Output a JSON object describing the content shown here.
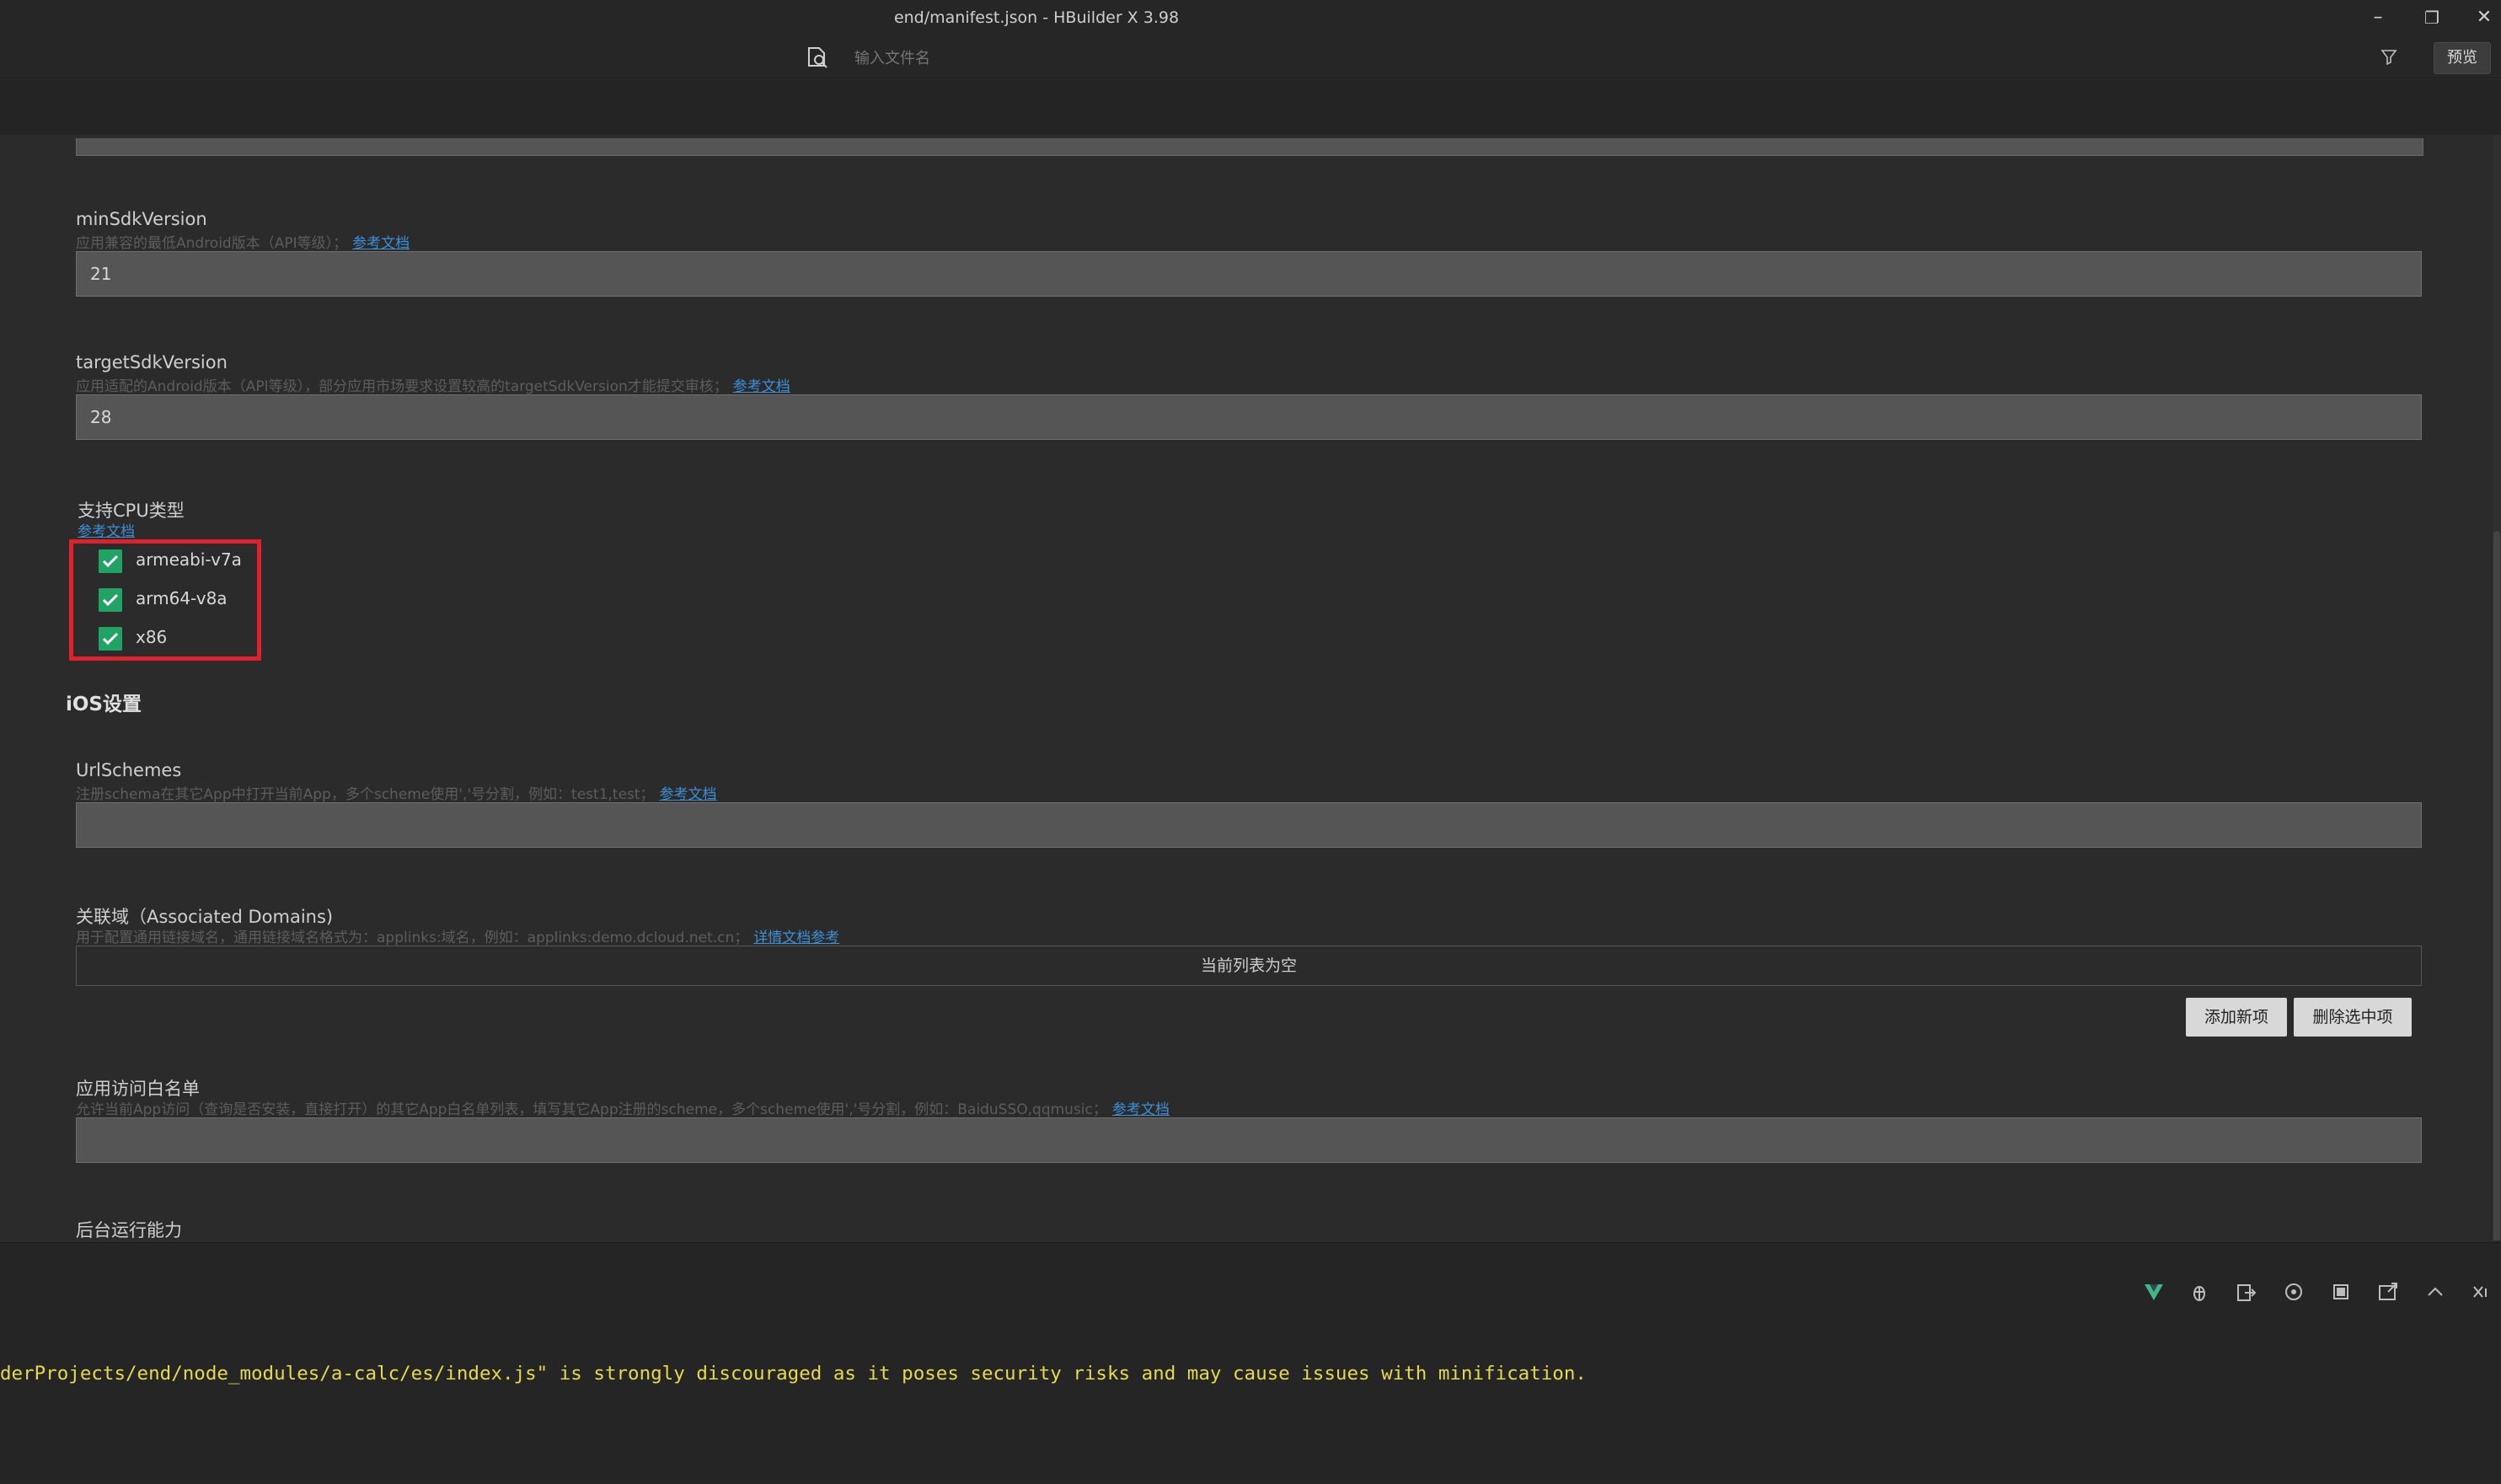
{
  "window": {
    "title": "end/manifest.json - HBuilder X 3.98",
    "controls": [
      "minimize-icon",
      "restore-icon",
      "close-icon"
    ]
  },
  "search": {
    "placeholder": "输入文件名",
    "value": ""
  },
  "header": {
    "preview_label": "预览"
  },
  "fields": {
    "minSdk": {
      "label": "minSdkVersion",
      "desc": "应用兼容的最低Android版本（API等级）；",
      "link": "参考文档",
      "value": "21"
    },
    "targetSdk": {
      "label": "targetSdkVersion",
      "desc": "应用适配的Android版本（API等级），部分应用市场要求设置较高的targetSdkVersion才能提交审核；",
      "link": "参考文档",
      "value": "28"
    },
    "cpu": {
      "label": "支持CPU类型",
      "link": "参考文档",
      "options": [
        {
          "label": "armeabi-v7a",
          "checked": true
        },
        {
          "label": "arm64-v8a",
          "checked": true
        },
        {
          "label": "x86",
          "checked": true
        }
      ]
    },
    "ios_section_title": "iOS设置",
    "urlSchemes": {
      "label": "UrlSchemes",
      "desc": "注册schema在其它App中打开当前App，多个scheme使用','号分割，例如：test1,test；",
      "link": "参考文档",
      "value": ""
    },
    "associatedDomains": {
      "label": "关联域（Associated Domains)",
      "desc": "用于配置通用链接域名，通用链接域名格式为：applinks:域名，例如：applinks:demo.dcloud.net.cn；",
      "link": "详情文档参考",
      "empty_text": "当前列表为空",
      "add_label": "添加新项",
      "delete_label": "删除选中项"
    },
    "whitelist": {
      "label": "应用访问白名单",
      "desc": "允许当前App访问（查询是否安装，直接打开）的其它App白名单列表，填写其它App注册的scheme，多个scheme使用','号分割，例如：BaiduSSO,qqmusic；",
      "link": "参考文档",
      "value": ""
    },
    "background": {
      "label": "后台运行能力"
    }
  },
  "panel": {
    "icons": [
      "vue-icon",
      "bug-icon",
      "export-icon",
      "reload-icon",
      "stop-icon",
      "open-external-icon",
      "chevron-up-icon",
      "close-panel-icon"
    ],
    "console": "derProjects/end/node_modules/a-calc/es/index.js\" is strongly discouraged as it poses security risks and may cause issues with minification."
  },
  "colors": {
    "accent_link": "#3d8fd6",
    "checkbox": "#21a366",
    "highlight_border": "#e0202a",
    "console_text": "#e6d94a"
  }
}
